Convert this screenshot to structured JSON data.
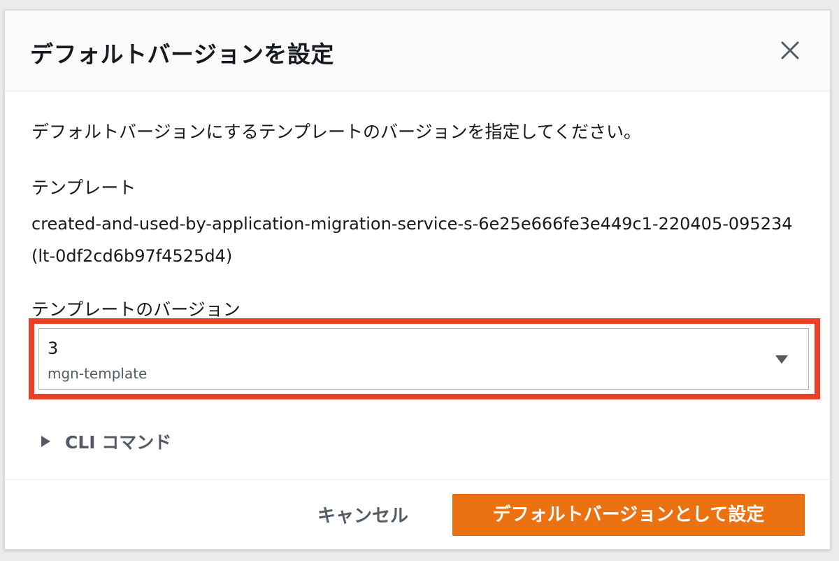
{
  "modal": {
    "title": "デフォルトバージョンを設定",
    "close_icon": "close-icon",
    "description": "デフォルトバージョンにするテンプレートのバージョンを指定してください。",
    "template_label": "テンプレート",
    "template_name": "created-and-used-by-application-migration-service-s-6e25e666fe3e449c1-220405-095234 (lt-0df2cd6b97f4525d4)",
    "version_label": "テンプレートのバージョン",
    "version_select": {
      "value": "3",
      "description": "mgn-template",
      "caret_icon": "caret-down-icon"
    },
    "cli_toggle": {
      "label": "CLI コマンド",
      "icon": "caret-right-icon"
    },
    "footer": {
      "cancel_label": "キャンセル",
      "primary_label": "デフォルトバージョンとして設定"
    }
  },
  "colors": {
    "primary": "#ec7211",
    "highlight": "#e84127",
    "text": "#16191f",
    "secondary_text": "#545b64"
  }
}
